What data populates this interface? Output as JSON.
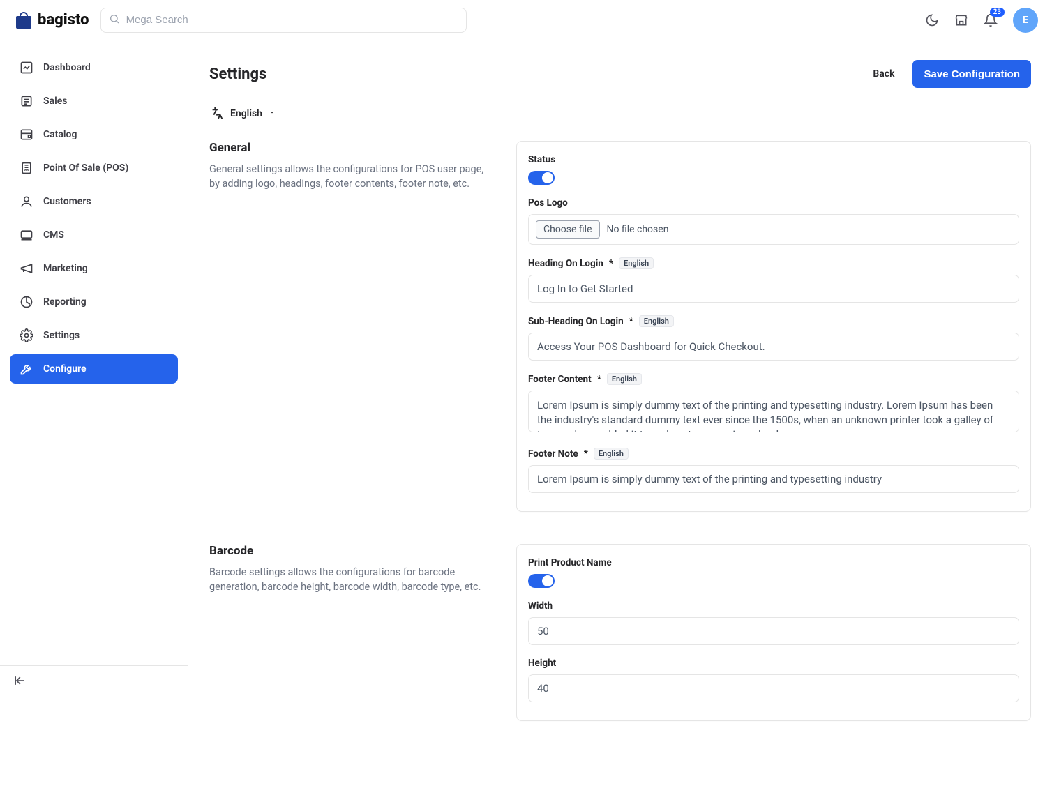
{
  "brand": "bagisto",
  "search": {
    "placeholder": "Mega Search"
  },
  "notifications": {
    "count": "23"
  },
  "avatar": {
    "initial": "E"
  },
  "sidebar": {
    "items": [
      {
        "label": "Dashboard"
      },
      {
        "label": "Sales"
      },
      {
        "label": "Catalog"
      },
      {
        "label": "Point Of Sale (POS)"
      },
      {
        "label": "Customers"
      },
      {
        "label": "CMS"
      },
      {
        "label": "Marketing"
      },
      {
        "label": "Reporting"
      },
      {
        "label": "Settings"
      },
      {
        "label": "Configure"
      }
    ]
  },
  "page": {
    "title": "Settings",
    "back": "Back",
    "save": "Save Configuration",
    "language": "English"
  },
  "general": {
    "heading": "General",
    "desc": "General settings allows the configurations for POS user page, by adding logo, headings, footer contents, footer note, etc.",
    "status_label": "Status",
    "pos_logo_label": "Pos Logo",
    "file_btn": "Choose file",
    "file_status": "No file chosen",
    "heading_login_label": "Heading On Login",
    "heading_login_value": "Log In to Get Started",
    "subheading_login_label": "Sub-Heading On Login",
    "subheading_login_value": "Access Your POS Dashboard for Quick Checkout.",
    "footer_content_label": "Footer Content",
    "footer_content_value": "Lorem Ipsum is simply dummy text of the printing and typesetting industry. Lorem Ipsum has been the industry's standard dummy text ever since the 1500s, when an unknown printer took a galley of type and scrambled it to make a type specimen book.",
    "footer_note_label": "Footer Note",
    "footer_note_value": "Lorem Ipsum is simply dummy text of the printing and typesetting industry",
    "lang_tag": "English"
  },
  "barcode": {
    "heading": "Barcode",
    "desc": "Barcode settings allows the configurations for barcode generation, barcode height, barcode width, barcode type, etc.",
    "print_name_label": "Print Product Name",
    "width_label": "Width",
    "width_value": "50",
    "height_label": "Height",
    "height_value": "40"
  }
}
